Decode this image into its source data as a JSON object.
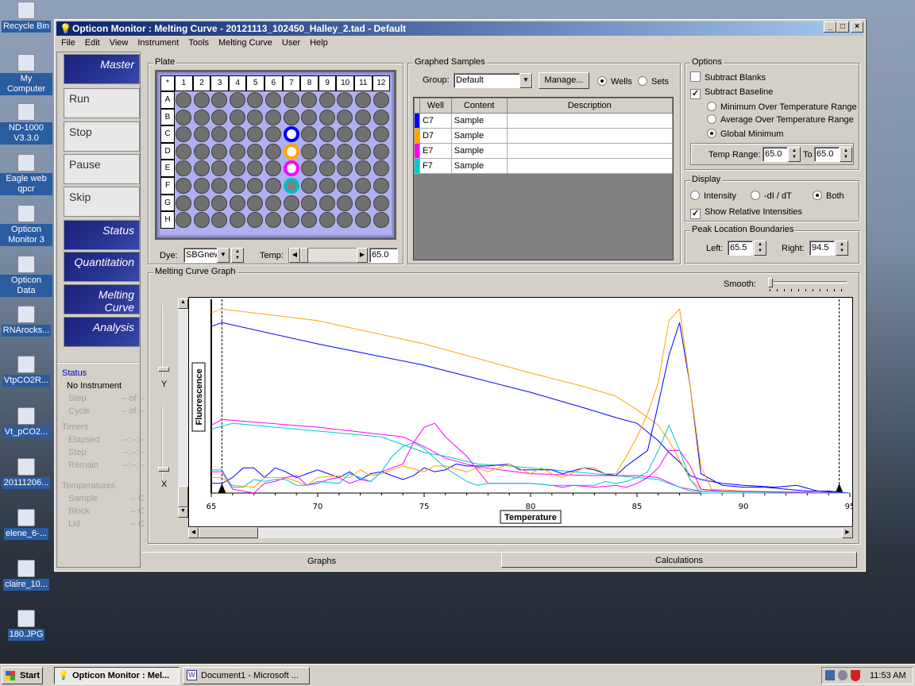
{
  "desktop": {
    "icons": [
      {
        "label": "Recycle Bin",
        "icon": "recycle-bin-icon"
      },
      {
        "label": "My Computer",
        "icon": "computer-icon"
      },
      {
        "label": "ND-1000 V3.3.0",
        "icon": "app-icon"
      },
      {
        "label": "Eagle web qpcr",
        "icon": "folder-icon"
      },
      {
        "label": "Opticon Monitor 3",
        "icon": "lightbulb-icon"
      },
      {
        "label": "Opticon Data",
        "icon": "folder-icon"
      },
      {
        "label": "RNArocks...",
        "icon": "notepad-icon"
      },
      {
        "label": "VtpCO2R...",
        "icon": "notepad-icon"
      },
      {
        "label": "Vt_pCO2...",
        "icon": "notepad-icon"
      },
      {
        "label": "20111206...",
        "icon": "lightbulb-file-icon"
      },
      {
        "label": "elene_6-...",
        "icon": "notepad-icon"
      },
      {
        "label": "claire_10...",
        "icon": "image-file-icon"
      },
      {
        "label": "180.JPG",
        "icon": "image-file-icon"
      }
    ]
  },
  "window": {
    "title": "Opticon Monitor : Melting Curve - 20121113_102450_Halley_2.tad - Default",
    "menu": [
      "File",
      "Edit",
      "View",
      "Instrument",
      "Tools",
      "Melting Curve",
      "User",
      "Help"
    ]
  },
  "nav": [
    "Master",
    "Run",
    "Stop",
    "Pause",
    "Skip",
    "Status",
    "Quantitation",
    "Melting Curve",
    "Analysis"
  ],
  "status": {
    "heading": "Status",
    "instrument": "No Instrument",
    "step_label": "Step",
    "step_value": "-- of --",
    "cycle_label": "Cycle",
    "cycle_value": "-- of --",
    "timers": "Timers",
    "elapsed_label": "Elapsed",
    "elapsed_value": "--:--:--",
    "tstep_label": "Step",
    "tstep_value": "--:--:--",
    "remain_label": "Remain",
    "remain_value": "--:--:--",
    "temps": "Temperatures",
    "sample_label": "Sample",
    "sample_value": "-- C",
    "block_label": "Block",
    "block_value": "-- C",
    "lid_label": "Lid",
    "lid_value": "-- C"
  },
  "plate": {
    "label": "Plate",
    "corner": "*",
    "columns": [
      "1",
      "2",
      "3",
      "4",
      "5",
      "6",
      "7",
      "8",
      "9",
      "10",
      "11",
      "12"
    ],
    "rows": [
      "A",
      "B",
      "C",
      "D",
      "E",
      "F",
      "G",
      "H"
    ],
    "selected_wells": [
      {
        "well": "C7",
        "color": "#0000ff"
      },
      {
        "well": "D7",
        "color": "#ffa500"
      },
      {
        "well": "E7",
        "color": "#ff00ff"
      },
      {
        "well": "F7",
        "color": "#00c0c0"
      }
    ],
    "dye_label": "Dye:",
    "dye_value": "SBGnew",
    "temp_label": "Temp:",
    "temp_value": "65.0"
  },
  "graphed_samples": {
    "label": "Graphed Samples",
    "group_label": "Group:",
    "group_value": "Default",
    "manage": "Manage...",
    "wells": "Wells",
    "sets": "Sets",
    "mode": "Wells",
    "headers": [
      "Well",
      "Content",
      "Description"
    ],
    "rows": [
      {
        "well": "C7",
        "content": "Sample",
        "description": "",
        "color": "#0000ff"
      },
      {
        "well": "D7",
        "content": "Sample",
        "description": "",
        "color": "#ffa500"
      },
      {
        "well": "E7",
        "content": "Sample",
        "description": "",
        "color": "#ff00ff"
      },
      {
        "well": "F7",
        "content": "Sample",
        "description": "",
        "color": "#00c8c8"
      }
    ]
  },
  "options": {
    "label": "Options",
    "subtract_blanks": "Subtract Blanks",
    "subtract_blanks_checked": false,
    "subtract_baseline": "Subtract Baseline",
    "subtract_baseline_checked": true,
    "min_range": "Minimum Over Temperature Range",
    "avg_range": "Average Over Temperature Range",
    "global_min": "Global Minimum",
    "baseline_mode": "Global Minimum",
    "temp_range_label": "Temp Range:",
    "temp_from": "65.0",
    "to_label": "To",
    "temp_to": "65.0"
  },
  "display": {
    "label": "Display",
    "intensity": "Intensity",
    "derivative": "-dI / dT",
    "both": "Both",
    "mode": "Both",
    "show_relative": "Show Relative Intensities",
    "show_relative_checked": true
  },
  "peak": {
    "label": "Peak Location Boundaries",
    "left_label": "Left:",
    "left": "65.5",
    "right_label": "Right:",
    "right": "94.5"
  },
  "graph": {
    "label": "Melting Curve Graph",
    "smooth_label": "Smooth:",
    "smooth_level": 0,
    "y_slider_label": "Y",
    "x_slider_label": "X"
  },
  "tabs": [
    {
      "label": "Graphs",
      "active": true
    },
    {
      "label": "Calculations",
      "active": false
    }
  ],
  "taskbar": {
    "start": "Start",
    "items": [
      "Opticon Monitor : Mel...",
      "Document1 - Microsoft ..."
    ],
    "clock": "11:53 AM"
  },
  "chart_data": {
    "type": "line",
    "xlabel": "Temperature",
    "ylabel": "Fluorescence",
    "xlim": [
      65,
      95
    ],
    "ylim": [
      0,
      1
    ],
    "xticks": [
      "65",
      "70",
      "75",
      "80",
      "85",
      "90",
      "95"
    ],
    "grid": false,
    "boundaries": [
      65.5,
      94.5
    ],
    "series": [
      {
        "well": "C7",
        "color": "#0000ff",
        "kind": "intensity",
        "x": [
          65,
          65.5,
          70,
          75,
          80,
          82.5,
          84,
          85,
          86,
          86.5,
          87,
          87.5,
          88,
          89,
          90,
          91.5,
          92.5,
          93.5,
          95
        ],
        "y": [
          0.86,
          0.88,
          0.77,
          0.66,
          0.52,
          0.44,
          0.39,
          0.36,
          0.27,
          0.21,
          0.16,
          0.09,
          0.07,
          0.05,
          0.04,
          0.03,
          0.04,
          0.01,
          0
        ]
      },
      {
        "well": "D7",
        "color": "#ffa500",
        "kind": "intensity",
        "x": [
          65,
          65.5,
          70,
          75,
          80,
          82.5,
          84,
          85,
          86,
          86.5,
          87,
          87.5,
          88,
          89,
          95
        ],
        "y": [
          0.93,
          0.95,
          0.89,
          0.77,
          0.62,
          0.55,
          0.5,
          0.43,
          0.35,
          0.27,
          0.17,
          0.07,
          0.02,
          0.01,
          0
        ]
      },
      {
        "well": "E7",
        "color": "#ff00ff",
        "kind": "intensity",
        "x": [
          65,
          65.5,
          70,
          74,
          75,
          76,
          77.5,
          80,
          83,
          85,
          86,
          87,
          88,
          95
        ],
        "y": [
          0.35,
          0.38,
          0.34,
          0.29,
          0.24,
          0.18,
          0.135,
          0.1,
          0.09,
          0.09,
          0.08,
          0.03,
          0.01,
          0
        ]
      },
      {
        "well": "F7",
        "color": "#00c8c8",
        "kind": "intensity",
        "x": [
          65,
          66,
          70,
          73,
          75,
          76,
          77.5,
          79,
          80,
          83,
          85,
          86,
          86.5,
          87.5,
          95
        ],
        "y": [
          0.33,
          0.36,
          0.32,
          0.29,
          0.21,
          0.19,
          0.15,
          0.14,
          0.13,
          0.1,
          0.08,
          0.07,
          0.05,
          0.01,
          0
        ]
      },
      {
        "well": "C7",
        "color": "#0000ff",
        "kind": "-dI/dT",
        "x": [
          65,
          65.5,
          66,
          66.5,
          67,
          67.5,
          68,
          68.5,
          69,
          69.5,
          70,
          70.5,
          71,
          71.5,
          72,
          72.5,
          73,
          74,
          74.5,
          75,
          75.5,
          76,
          76.5,
          77,
          78,
          79,
          79.5,
          80,
          81,
          81.5,
          82.5,
          83,
          83.5,
          84,
          84.5,
          85,
          85.5,
          86,
          86.5,
          87,
          87.5,
          88,
          88.5,
          89,
          90,
          91,
          92,
          93,
          94,
          95
        ],
        "y": [
          0.05,
          0.05,
          0.08,
          0.13,
          0.13,
          0.08,
          0.13,
          0.11,
          0.08,
          0.1,
          0.12,
          0.1,
          0.08,
          0.11,
          0.07,
          0.1,
          0.11,
          0.07,
          0.09,
          0.13,
          0.11,
          0.12,
          0.15,
          0.14,
          0.14,
          0.15,
          0.12,
          0.12,
          0.12,
          0.1,
          0.13,
          0.12,
          0.1,
          0.09,
          0.14,
          0.18,
          0.22,
          0.46,
          0.71,
          0.88,
          0.55,
          0.1,
          0.07,
          0.04,
          0.03,
          0.03,
          0.02,
          0.01,
          0.01,
          0
        ]
      },
      {
        "well": "D7",
        "color": "#ffa500",
        "kind": "-dI/dT",
        "x": [
          65,
          65.5,
          66,
          67,
          67.5,
          68.5,
          69.5,
          70,
          71,
          71.5,
          72,
          72.5,
          73,
          74,
          75,
          75.5,
          76,
          77,
          77.5,
          78,
          79,
          80,
          80.5,
          81,
          81.5,
          82.5,
          83,
          83.5,
          84,
          84.5,
          85,
          85.5,
          86,
          86.5,
          87,
          87.5,
          88,
          88.5,
          90,
          95
        ],
        "y": [
          0.08,
          0.08,
          0.04,
          0.03,
          0.08,
          0.08,
          0.04,
          0.08,
          0.09,
          0.08,
          0.12,
          0.09,
          0.1,
          0.14,
          0.11,
          0.14,
          0.14,
          0.11,
          0.13,
          0.11,
          0.15,
          0.1,
          0.13,
          0.1,
          0.08,
          0.13,
          0.13,
          0.1,
          0.1,
          0.19,
          0.29,
          0.41,
          0.57,
          0.89,
          0.95,
          0.55,
          0.14,
          0.02,
          0.01,
          0
        ]
      },
      {
        "well": "E7",
        "color": "#ff00ff",
        "kind": "-dI/dT",
        "x": [
          65,
          65.5,
          66,
          67,
          67.5,
          68,
          68.5,
          69,
          69.5,
          70,
          70.5,
          71,
          71.5,
          72,
          72.5,
          73,
          74,
          74.5,
          75,
          75.5,
          76,
          77,
          77.5,
          78,
          79,
          80,
          81,
          81.5,
          82,
          83,
          84,
          84.5,
          85,
          85.5,
          86,
          86.5,
          87,
          87.5,
          88,
          89,
          95
        ],
        "y": [
          0.11,
          0.11,
          0.02,
          0,
          0.05,
          0.06,
          0.08,
          0.09,
          0.04,
          0.05,
          0.07,
          0.08,
          0.05,
          0.07,
          0.06,
          0.11,
          0.15,
          0.26,
          0.34,
          0.36,
          0.29,
          0.19,
          0.12,
          0.05,
          0.05,
          0.05,
          0.04,
          0.03,
          0.04,
          0.03,
          0.04,
          0.03,
          0.05,
          0.08,
          0.13,
          0.22,
          0.22,
          0.14,
          0.02,
          0.01,
          0
        ]
      },
      {
        "well": "F7",
        "color": "#00c8c8",
        "kind": "-dI/dT",
        "x": [
          65,
          65.5,
          66,
          66.5,
          67,
          67.5,
          68,
          68.5,
          69,
          69.5,
          70,
          71,
          71.5,
          72,
          72.5,
          73,
          73.5,
          74,
          74.5,
          75,
          75.5,
          76,
          77,
          77.5,
          78,
          79,
          80,
          81,
          82,
          83,
          83.5,
          84,
          84.5,
          85,
          85.5,
          86,
          86.5,
          87,
          87.5,
          88,
          95
        ],
        "y": [
          0.12,
          0.12,
          0.03,
          0.03,
          0.07,
          0.06,
          0.07,
          0.07,
          0.04,
          0.04,
          0.06,
          0.05,
          0.1,
          0.08,
          0.06,
          0.11,
          0.19,
          0.24,
          0.26,
          0.23,
          0.18,
          0.13,
          0.06,
          0.04,
          0.05,
          0.05,
          0.05,
          0.04,
          0.04,
          0.04,
          0.06,
          0.05,
          0.06,
          0.08,
          0.11,
          0.22,
          0.35,
          0.22,
          0.07,
          0,
          0
        ]
      }
    ]
  }
}
